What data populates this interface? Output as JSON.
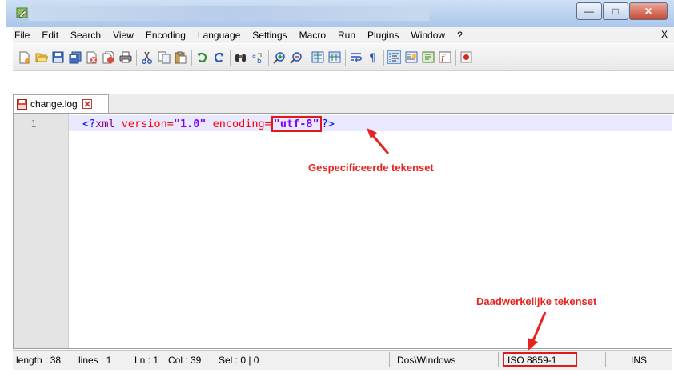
{
  "menu": [
    "File",
    "Edit",
    "Search",
    "View",
    "Encoding",
    "Language",
    "Settings",
    "Macro",
    "Run",
    "Plugins",
    "Window",
    "?"
  ],
  "menu_close": "X",
  "toolbar_icons": [
    "new-file-icon",
    "open-file-icon",
    "save-icon",
    "save-all-icon",
    "close-icon",
    "close-all-icon",
    "print-icon",
    "cut-icon",
    "copy-icon",
    "paste-icon",
    "undo-icon",
    "redo-icon",
    "find-icon",
    "replace-icon",
    "zoom-in-icon",
    "zoom-out-icon",
    "sync-vertical-icon",
    "sync-horizontal-icon",
    "word-wrap-icon",
    "show-all-chars-icon",
    "indent-guide-icon",
    "doc-map-icon",
    "function-list-icon",
    "macro-record-icon"
  ],
  "tab": {
    "label": "change.log"
  },
  "editor": {
    "line_number": "1",
    "code": {
      "open": "<?",
      "name": "xml",
      "attr1": "version=",
      "val1": "\"1.0\"",
      "attr2": "encoding=",
      "val2": "\"utf-8\"",
      "close": "?>"
    }
  },
  "annotations": {
    "specified": "Gespecificeerde tekenset",
    "actual": "Daadwerkelijke tekenset",
    "color": "#e8231f"
  },
  "status": {
    "length": "length : 38",
    "lines": "lines : 1",
    "ln": "Ln : 1",
    "col": "Col : 39",
    "sel": "Sel : 0 | 0",
    "eol": "Dos\\Windows",
    "encoding": "ISO 8859-1",
    "mode": "INS"
  }
}
